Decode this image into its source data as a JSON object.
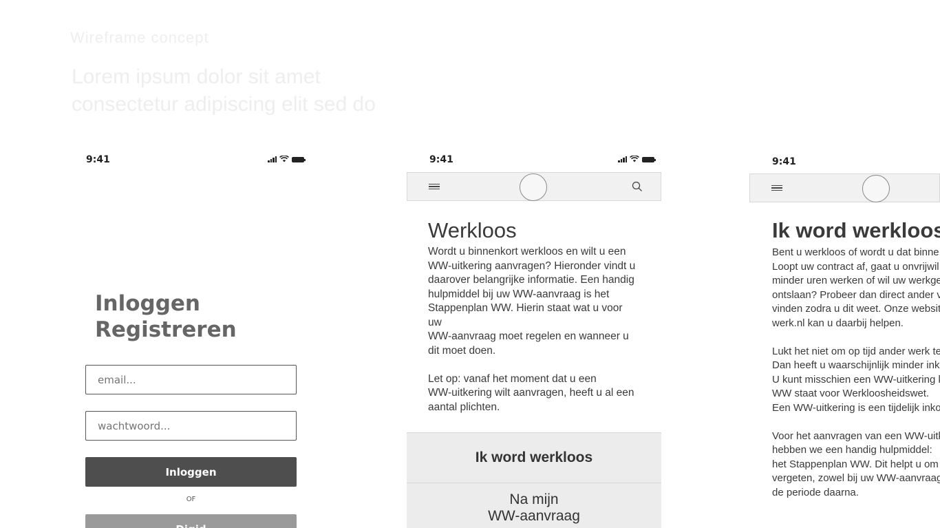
{
  "background_faded": {
    "line1": "Wireframe concept",
    "line2": "Lorem ipsum dolor sit amet consectetur adipiscing elit sed do"
  },
  "status_bar": {
    "time": "9:41"
  },
  "login_screen": {
    "title_line1": "Inloggen",
    "title_line2": "Registreren",
    "email_placeholder": "email...",
    "password_placeholder": "wachtwoord...",
    "login_button": "Inloggen",
    "or_text": "OF",
    "second_button": "Digid"
  },
  "werkloos_screen": {
    "title": "Werkloos",
    "paragraph1": "Wordt u binnenkort werkloos en wilt u een\nWW-uitkering aanvragen? Hieronder vindt u\ndaarover belangrijke informatie. Een handig\nhulpmiddel bij uw WW-aanvraag is het\nStappenplan WW. Hierin staat wat u voor\nuw\nWW-aanvraag moet regelen en wanneer u\ndit moet doen.",
    "paragraph2": "Let op: vanaf het moment dat u een\nWW-uitkering wilt aanvragen, heeft u al een\naantal plichten.",
    "accordion": [
      {
        "label": "Ik word werkloos"
      },
      {
        "label": "Na mijn\nWW-aanvraag"
      }
    ]
  },
  "ik_word_werkloos_screen": {
    "title": "Ik word werkloos",
    "paragraph1": "Bent u werkloos of wordt u dat binne\nLoopt uw contract af, gaat u onvrijwil\nminder uren werken of wil uw werkge\nontslaan? Probeer dan direct ander v\nvinden zodra u dit weet. Onze websit\nwerk.nl kan u daarbij helpen.",
    "paragraph2": "Lukt het niet om op tijd ander werk te\nDan heeft u waarschijnlijk minder ink\nU kunt misschien een WW-uitkering k\nWW staat voor Werkloosheidswet.\nEen WW-uitkering is een tijdelijk inkor",
    "paragraph3": "Voor het aanvragen van een WW-uitk\nhebben we een handig hulpmiddel:\nhet Stappenplan WW. Dit helpt u om\nvergeten, zowel bij uw WW-aanvraag\nde periode daarna."
  }
}
